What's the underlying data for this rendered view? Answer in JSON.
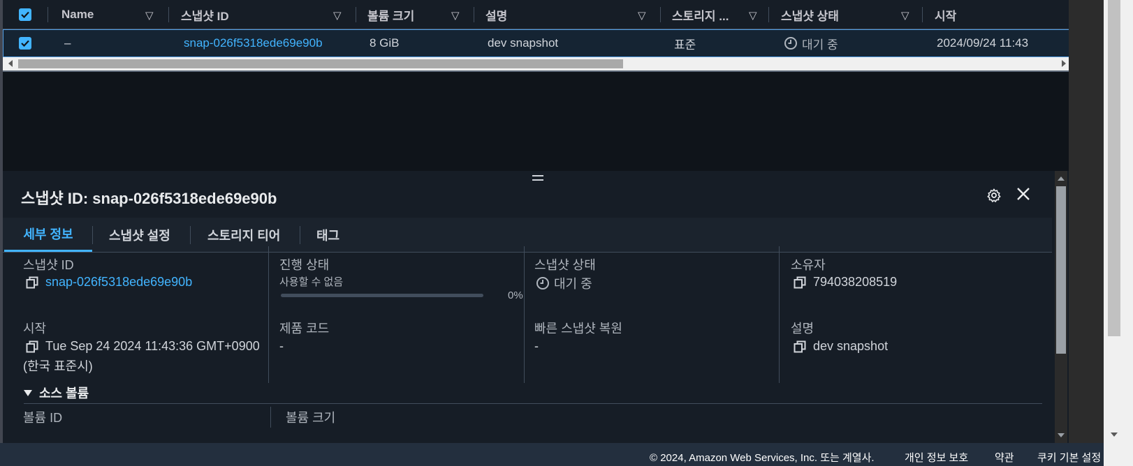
{
  "table": {
    "columns": {
      "name": "Name",
      "snapshot_id": "스냅샷 ID",
      "volume_size": "볼륨 크기",
      "description": "설명",
      "storage": "스토리지 ...",
      "snapshot_status": "스냅샷 상태",
      "start": "시작"
    },
    "row": {
      "name": "–",
      "snapshot_id": "snap-026f5318ede69e90b",
      "volume_size": "8 GiB",
      "description": "dev snapshot",
      "storage": "표준",
      "snapshot_status": "대기 중",
      "start": "2024/09/24 11:43"
    }
  },
  "panel": {
    "title": "스냅샷 ID: snap-026f5318ede69e90b",
    "tabs": [
      "세부 정보",
      "스냅샷 설정",
      "스토리지 티어",
      "태그"
    ],
    "details": {
      "snapshot_id_label": "스냅샷 ID",
      "snapshot_id_value": "snap-026f5318ede69e90b",
      "progress_label": "진행 상태",
      "progress_sub": "사용할 수 없음",
      "progress_pct": "0%",
      "progress_value": 0,
      "status_label": "스냅샷 상태",
      "status_value": "대기 중",
      "owner_label": "소유자",
      "owner_value": "794038208519",
      "start_label": "시작",
      "start_value_line1": "Tue Sep 24 2024 11:43:36 GMT+0900",
      "start_value_line2": "(한국 표준시)",
      "product_code_label": "제품 코드",
      "product_code_value": "-",
      "fast_restore_label": "빠른 스냅샷 복원",
      "fast_restore_value": "-",
      "description_label": "설명",
      "description_value": "dev snapshot"
    },
    "source_volume": {
      "title": "소스 볼륨",
      "volume_id_label": "볼륨 ID",
      "volume_size_label": "볼륨 크기"
    }
  },
  "footer": {
    "copyright": "© 2024, Amazon Web Services, Inc. 또는 계열사.",
    "privacy": "개인 정보 보호",
    "terms": "약관",
    "cookies": "쿠키 기본 설정"
  },
  "colors": {
    "accent": "#42b4ff",
    "panel_bg": "#161d26",
    "page_bg": "#0f141a",
    "footer_bg": "#232f3e"
  },
  "icons": [
    "checkbox-icon",
    "sort-icon",
    "clock-icon",
    "copy-icon",
    "gear-icon",
    "close-icon"
  ]
}
